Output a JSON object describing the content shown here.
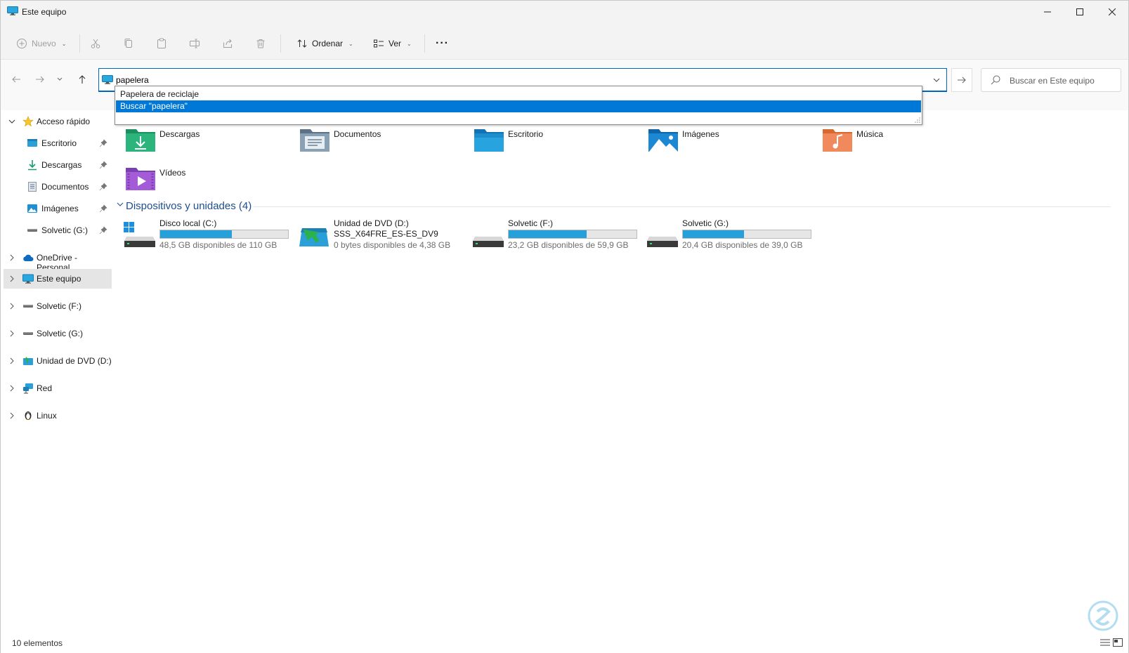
{
  "window": {
    "title": "Este equipo",
    "controls": {
      "minimize": "—",
      "maximize": "☐",
      "close": "✕"
    }
  },
  "toolbar": {
    "new_label": "Nuevo",
    "sort_label": "Ordenar",
    "view_label": "Ver",
    "more_label": "···"
  },
  "address": {
    "value": "papelera",
    "search_placeholder": "Buscar en Este equipo"
  },
  "autocomplete": {
    "items": [
      "Papelera de reciclaje",
      "Buscar \"papelera\""
    ],
    "selected_index": 1
  },
  "sidebar": {
    "quick_access": "Acceso rápido",
    "pinned": [
      "Escritorio",
      "Descargas",
      "Documentos",
      "Imágenes",
      "Solvetic (G:)"
    ],
    "items": [
      "OneDrive - Personal",
      "Este equipo",
      "Solvetic (F:)",
      "Solvetic (G:)",
      "Unidad de DVD (D:)",
      "Red",
      "Linux"
    ],
    "selected": "Este equipo"
  },
  "folders": [
    "Descargas",
    "Documentos",
    "Escritorio",
    "Imágenes",
    "Música",
    "Vídeos"
  ],
  "devices_group": "Dispositivos y unidades (4)",
  "drives": [
    {
      "name": "Disco local (C:)",
      "free": "48,5 GB disponibles de 110 GB",
      "used_fraction": 0.56
    },
    {
      "name": "Unidad de DVD (D:)",
      "label": "SSS_X64FRE_ES-ES_DV9",
      "free": "0 bytes disponibles de 4,38 GB"
    },
    {
      "name": "Solvetic (F:)",
      "free": "23,2 GB disponibles de 59,9 GB",
      "used_fraction": 0.61
    },
    {
      "name": "Solvetic (G:)",
      "free": "20,4 GB disponibles de 39,0 GB",
      "used_fraction": 0.48
    }
  ],
  "status": {
    "count": "10 elementos"
  },
  "colors": {
    "accent": "#0078d7",
    "group_title": "#1e4e8c",
    "drive_bar": "#26a0da"
  }
}
